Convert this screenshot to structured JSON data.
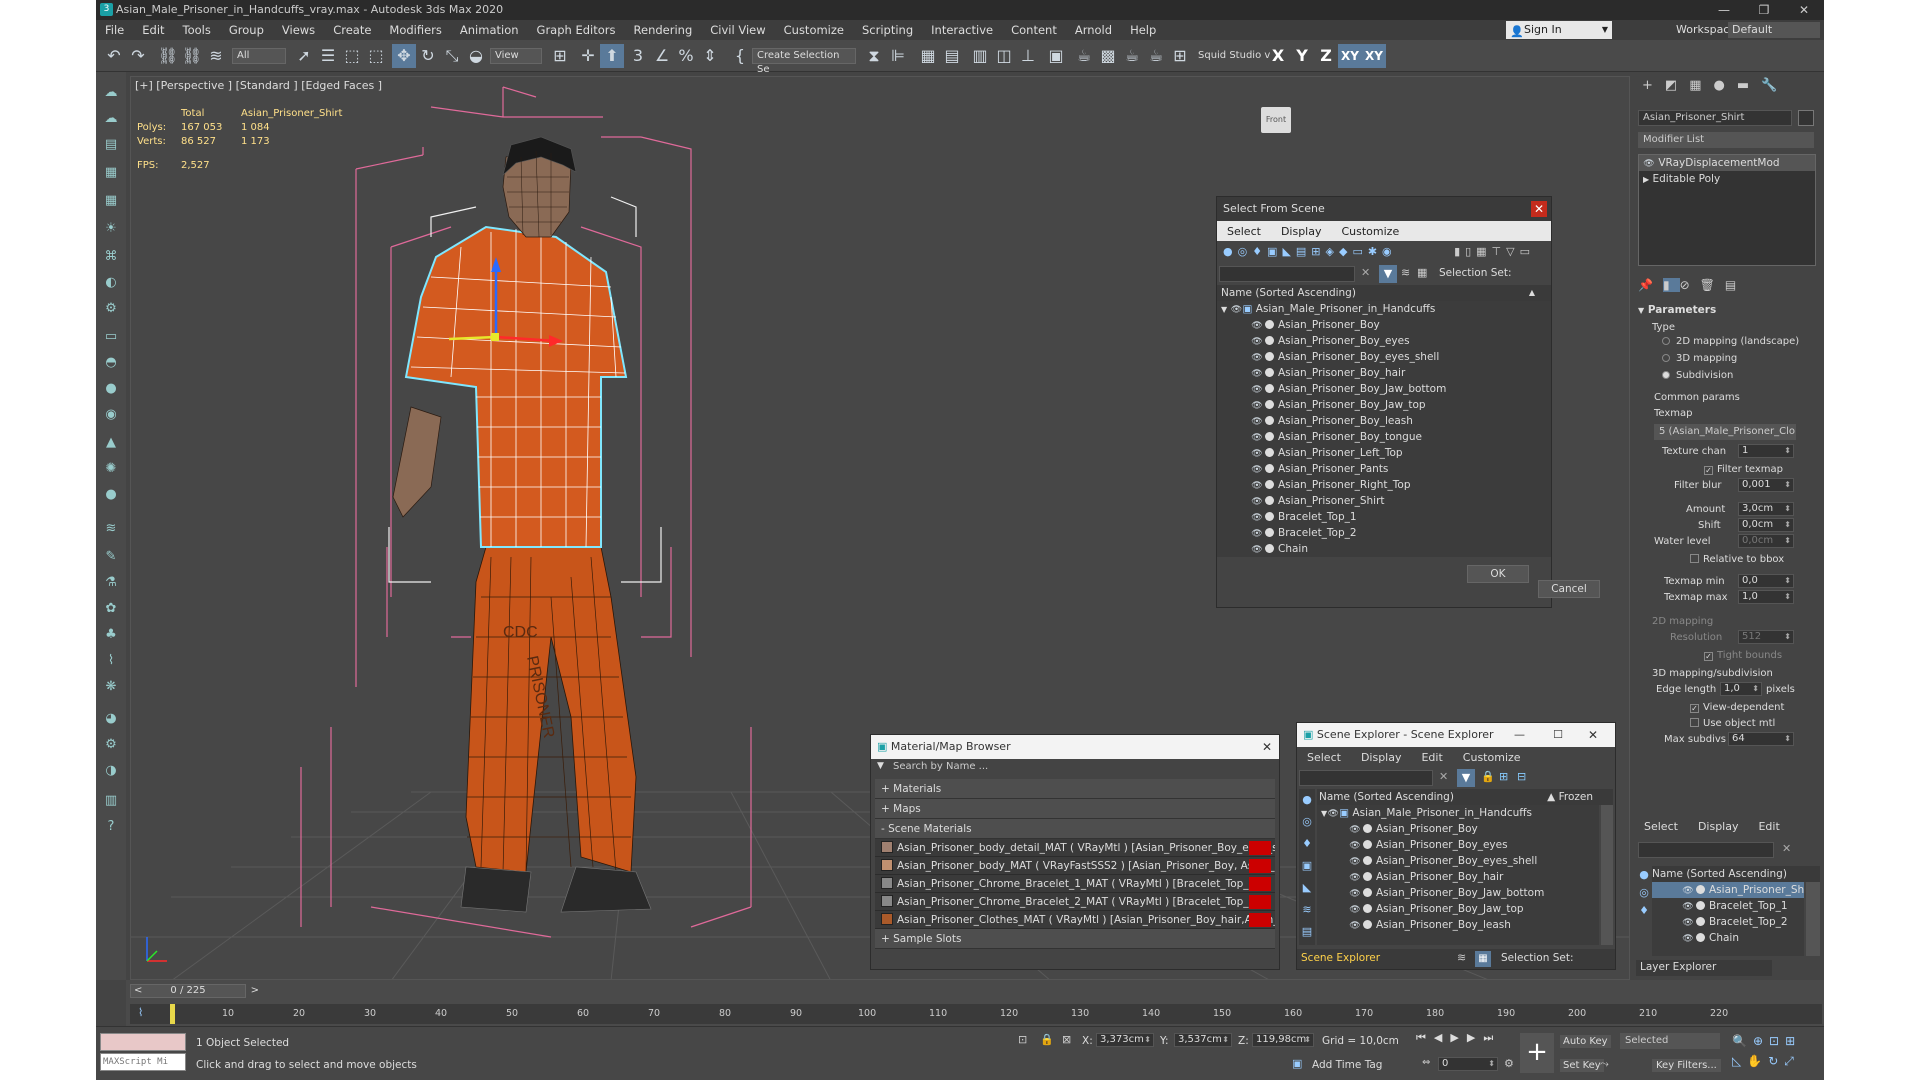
{
  "window": {
    "title": "Asian_Male_Prisoner_in_Handcuffs_vray.max - Autodesk 3ds Max 2020",
    "app_icon": "3",
    "controls": [
      "—",
      "❐",
      "✕"
    ]
  },
  "menu": [
    "File",
    "Edit",
    "Tools",
    "Group",
    "Views",
    "Create",
    "Modifiers",
    "Animation",
    "Graph Editors",
    "Rendering",
    "Civil View",
    "Customize",
    "Scripting",
    "Interactive",
    "Content",
    "Arnold",
    "Help"
  ],
  "signin": {
    "label": "Sign In"
  },
  "workspace": {
    "label": "Workspaces:",
    "value": "Default"
  },
  "toolbar": {
    "selection_filter": "All",
    "ref_coord": "View",
    "named_selection": "Create Selection Se",
    "squid": "Squid Studio v",
    "axes": [
      "X",
      "Y",
      "Z",
      "XY",
      "XY"
    ]
  },
  "viewport": {
    "label": "[+] [Perspective ] [Standard ] [Edged Faces ]",
    "stats": {
      "total_label": "Total",
      "object_label": "Asian_Prisoner_Shirt",
      "polys_label": "Polys:",
      "polys_total": "167 053",
      "polys_obj": "1 084",
      "verts_label": "Verts:",
      "verts_total": "86 527",
      "verts_obj": "1 173",
      "fps_label": "FPS:",
      "fps": "2,527"
    },
    "navcube_text": "Front",
    "shirt_print": "CDC",
    "pants_print": "PRISONER"
  },
  "select_from_scene": {
    "title": "Select From Scene",
    "menu": [
      "Select",
      "Display",
      "Customize"
    ],
    "selection_set_label": "Selection Set:",
    "column_header": "Name (Sorted Ascending)",
    "root": "Asian_Male_Prisoner_in_Handcuffs",
    "items": [
      "Asian_Prisoner_Boy",
      "Asian_Prisoner_Boy_eyes",
      "Asian_Prisoner_Boy_eyes_shell",
      "Asian_Prisoner_Boy_hair",
      "Asian_Prisoner_Boy_Jaw_bottom",
      "Asian_Prisoner_Boy_Jaw_top",
      "Asian_Prisoner_Boy_leash",
      "Asian_Prisoner_Boy_tongue",
      "Asian_Prisoner_Left_Top",
      "Asian_Prisoner_Pants",
      "Asian_Prisoner_Right_Top",
      "Asian_Prisoner_Shirt",
      "Bracelet_Top_1",
      "Bracelet_Top_2",
      "Chain"
    ],
    "ok": "OK",
    "cancel": "Cancel"
  },
  "material_browser": {
    "title": "Material/Map Browser",
    "search_placeholder": "Search by Name ...",
    "sections": {
      "materials": "+ Materials",
      "maps": "+ Maps",
      "scene": "- Scene Materials",
      "slots": "+ Sample Slots"
    },
    "rows": [
      "Asian_Prisoner_body_detail_MAT ( VRayMtl ) [Asian_Prisoner_Boy_eyes_she...",
      "Asian_Prisoner_body_MAT ( VRayFastSSS2 ) [Asian_Prisoner_Boy, Asian_Pri...",
      "Asian_Prisoner_Chrome_Bracelet_1_MAT ( VRayMtl ) [Bracelet_Top_1]",
      "Asian_Prisoner_Chrome_Bracelet_2_MAT ( VRayMtl ) [Bracelet_Top_2]",
      "Asian_Prisoner_Clothes_MAT ( VRayMtl ) [Asian_Prisoner_Boy_hair,Asian_P..."
    ]
  },
  "scene_explorer": {
    "title": "Scene Explorer - Scene Explorer",
    "menu": [
      "Select",
      "Display",
      "Edit",
      "Customize"
    ],
    "column_header": "Name (Sorted Ascending)",
    "frozen_header": "▲ Frozen",
    "root": "Asian_Male_Prisoner_in_Handcuffs",
    "items": [
      "Asian_Prisoner_Boy",
      "Asian_Prisoner_Boy_eyes",
      "Asian_Prisoner_Boy_eyes_shell",
      "Asian_Prisoner_Boy_hair",
      "Asian_Prisoner_Boy_Jaw_bottom",
      "Asian_Prisoner_Boy_Jaw_top",
      "Asian_Prisoner_Boy_leash"
    ],
    "footer_name": "Scene Explorer",
    "selection_set_label": "Selection Set:"
  },
  "command_panel": {
    "object_name": "Asian_Prisoner_Shirt",
    "modifier_list": "Modifier List",
    "stack": [
      "VRayDisplacementMod",
      "Editable Poly"
    ],
    "parameters_title": "Parameters",
    "type_label": "Type",
    "type_options": [
      "2D mapping (landscape)",
      "3D mapping",
      "Subdivision"
    ],
    "common_params": "Common params",
    "texmap_label": "Texmap",
    "texmap_value": "5 (Asian_Male_Prisoner_Cloth",
    "texture_chan_label": "Texture chan",
    "texture_chan": "1",
    "filter_texmap": "Filter texmap",
    "filter_blur_label": "Filter blur",
    "filter_blur": "0,001",
    "amount_label": "Amount",
    "amount": "3,0cm",
    "shift_label": "Shift",
    "shift": "0,0cm",
    "water_level_label": "Water level",
    "water_level": "0,0cm",
    "relative_bbox": "Relative to bbox",
    "texmap_min_label": "Texmap min",
    "texmap_min": "0,0",
    "texmap_max_label": "Texmap max",
    "texmap_max": "1,0",
    "mapping2d_label": "2D mapping",
    "resolution_label": "Resolution",
    "resolution": "512",
    "tight_bounds": "Tight bounds",
    "subdiv_label": "3D mapping/subdivision",
    "edge_length_label": "Edge length",
    "edge_length": "1,0",
    "pixels": "pixels",
    "view_dependent": "View-dependent",
    "use_object_mtl": "Use object mtl",
    "max_subdivs_label": "Max subdivs",
    "max_subdivs": "64"
  },
  "layer_explorer": {
    "menu": [
      "Select",
      "Display",
      "Edit"
    ],
    "column_header": "Name (Sorted Ascending)",
    "items": [
      "Asian_Prisoner_Shi",
      "Bracelet_Top_1",
      "Bracelet_Top_2",
      "Chain"
    ],
    "footer": "Layer Explorer"
  },
  "timeline": {
    "frame_display": "0 / 225",
    "ticks": [
      "10",
      "20",
      "30",
      "40",
      "50",
      "60",
      "70",
      "80",
      "90",
      "100",
      "110",
      "120",
      "130",
      "140",
      "150",
      "160",
      "170",
      "180",
      "190",
      "200",
      "210",
      "220"
    ]
  },
  "status": {
    "maxscript": "MAXScript Mi",
    "selected": "1 Object Selected",
    "prompt": "Click and drag to select and move objects",
    "x_label": "X:",
    "x": "3,373cm",
    "y_label": "Y:",
    "y": "3,537cm",
    "z_label": "Z:",
    "z": "119,98cm",
    "grid": "Grid = 10,0cm",
    "add_time_tag": "Add Time Tag",
    "auto_key": "Auto Key",
    "set_key": "Set Key",
    "selected_dd": "Selected",
    "key_filters": "Key Filters...",
    "frame": "0"
  }
}
